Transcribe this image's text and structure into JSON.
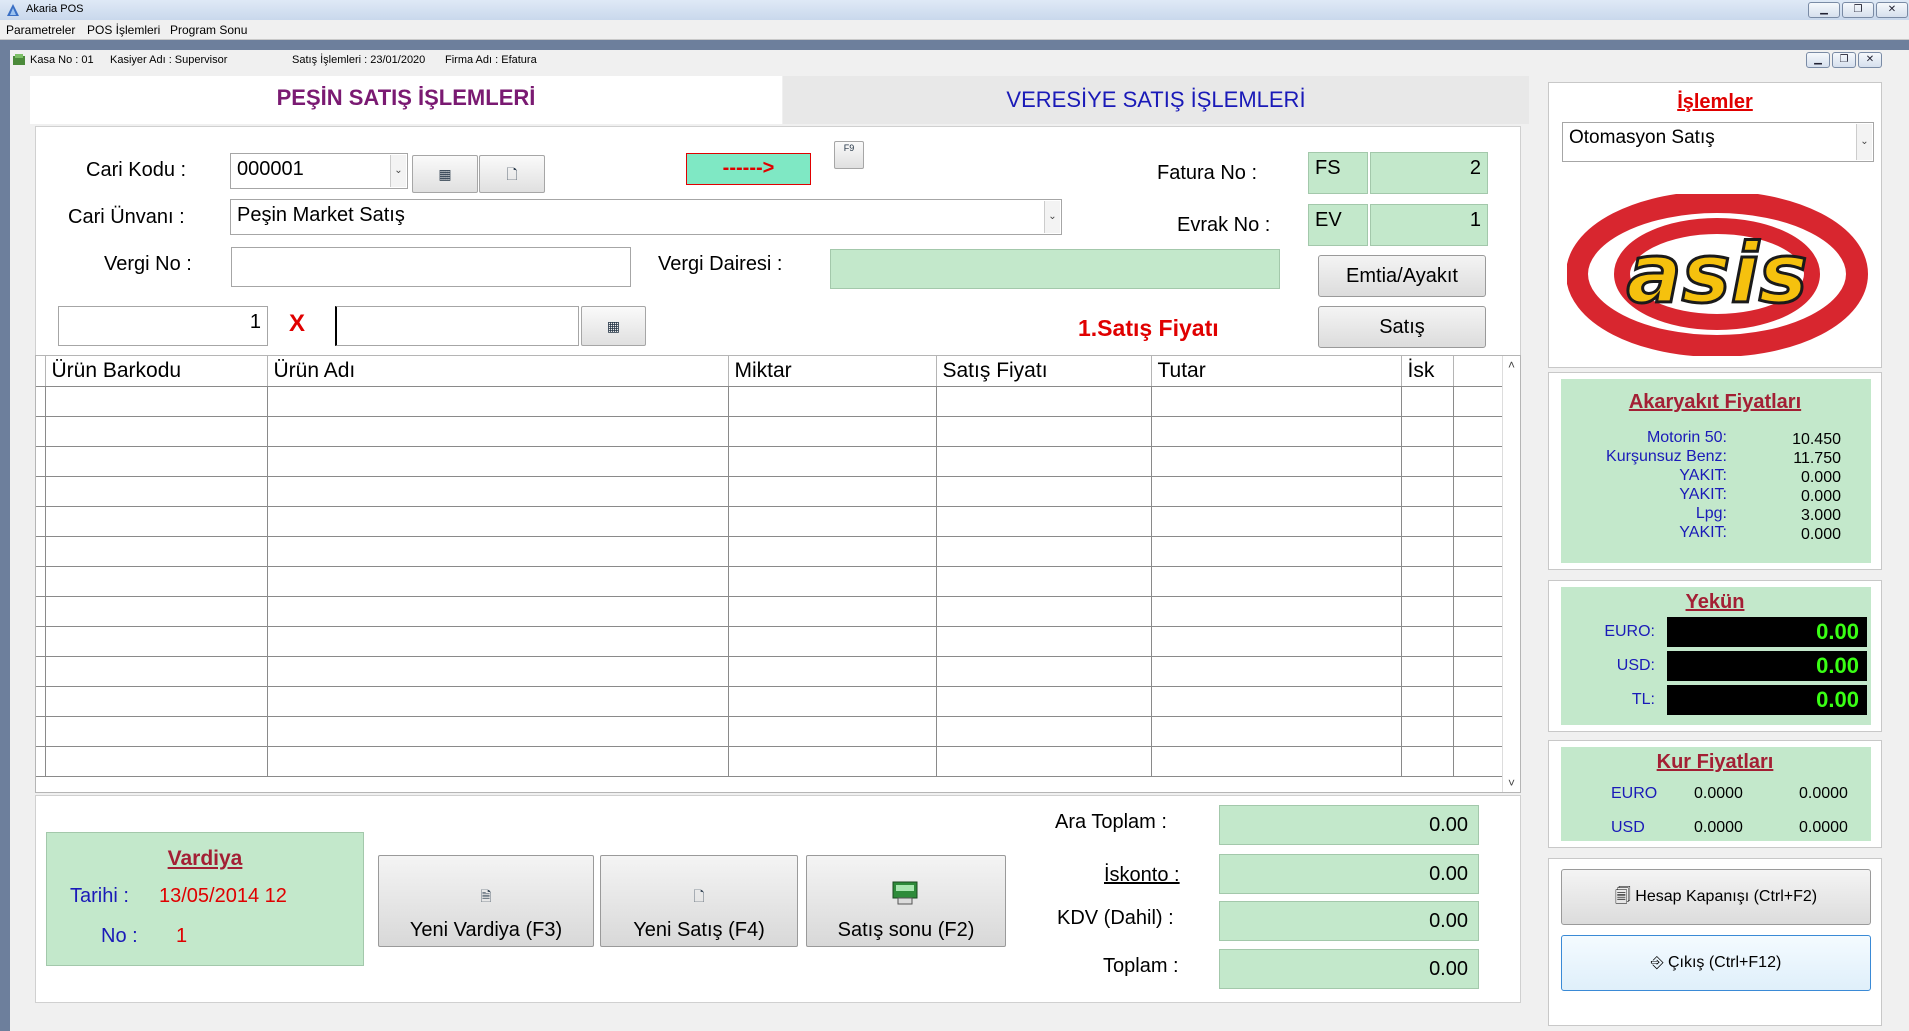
{
  "app": {
    "window_title": "Akaria POS",
    "menu": [
      "Parametreler",
      "POS İşlemleri",
      "Program Sonu"
    ]
  },
  "status": {
    "kasa": "Kasa No : 01",
    "kasiyer": "Kasiyer Adı : Supervisor",
    "satis_tarih": "Satış İşlemleri : 23/01/2020",
    "firma": "Firma Adı : Efatura"
  },
  "tabs": {
    "pesin": "PEŞİN SATIŞ İŞLEMLERİ",
    "veresiye": "VERESİYE SATIŞ İŞLEMLERİ"
  },
  "form": {
    "cari_kodu_label": "Cari Kodu :",
    "cari_kodu_value": "000001",
    "cari_unvani_label": "Cari Ünvanı :",
    "cari_unvani_value": "Peşin Market Satış",
    "vergi_no_label": "Vergi No :",
    "vergi_no_value": "",
    "vergi_dairesi_label": "Vergi Dairesi :",
    "vergi_dairesi_value": "",
    "arrow_text": "------>",
    "f9_key": "F9",
    "fatura_no_label": "Fatura  No :",
    "fatura_seri": "FS",
    "fatura_no": "2",
    "evrak_no_label": "Evrak No :",
    "evrak_seri": "EV",
    "evrak_no": "1",
    "emtia_button": "Emtia/Ayakıt",
    "satis_button": "Satış",
    "qty_value": "1",
    "multiply": "X",
    "barcode_value": "",
    "price_type": "1.Satış Fiyatı"
  },
  "grid": {
    "columns": [
      "Ürün Barkodu",
      "Ürün Adı",
      "Miktar",
      "Satış Fiyatı",
      "Tutar",
      "İsk",
      ""
    ],
    "rows": 13
  },
  "vardiya": {
    "title": "Vardiya",
    "tarih_label": "Tarihi :",
    "tarih_value": "13/05/2014 12",
    "no_label": "No :",
    "no_value": "1"
  },
  "actions": {
    "yeni_vardiya": "Yeni Vardiya (F3)",
    "yeni_satis": "Yeni Satış (F4)",
    "satis_sonu": "Satış sonu (F2)"
  },
  "totals": {
    "ara_toplam_label": "Ara Toplam :",
    "ara_toplam": "0.00",
    "iskonto_label": "İskonto :",
    "iskonto": "0.00",
    "kdv_label": "KDV (Dahil) :",
    "kdv": "0.00",
    "toplam_label": "Toplam :",
    "toplam": "0.00"
  },
  "sidebar": {
    "islemler_title": "İşlemler",
    "islemler_value": "Otomasyon Satış",
    "logo_text": "asis",
    "fuel_title": "Akaryakıt Fiyatları",
    "fuel": [
      {
        "name": "Motorin 50:",
        "price": "10.450"
      },
      {
        "name": "Kurşunsuz Benz:",
        "price": "11.750"
      },
      {
        "name": "YAKIT:",
        "price": "0.000"
      },
      {
        "name": "YAKIT:",
        "price": "0.000"
      },
      {
        "name": "Lpg:",
        "price": "3.000"
      },
      {
        "name": "YAKIT:",
        "price": "0.000"
      }
    ],
    "yekun_title": "Yekün",
    "yekun": [
      {
        "cur": "EURO:",
        "val": "0.00"
      },
      {
        "cur": "USD:",
        "val": "0.00"
      },
      {
        "cur": "TL:",
        "val": "0.00"
      }
    ],
    "kur_title": "Kur Fiyatları",
    "kur": [
      {
        "cur": "EURO",
        "a": "0.0000",
        "b": "0.0000"
      },
      {
        "cur": "USD",
        "a": "0.0000",
        "b": "0.0000"
      }
    ],
    "hesap_button": "Hesap Kapanışı (Ctrl+F2)",
    "cikis_button": "Çıkış (Ctrl+F12)"
  },
  "colors": {
    "green_field": "#c3e8cb",
    "tab_pesin": "#7a1a72",
    "tab_veresiye": "#1a1ab8",
    "accent_red": "#e00000"
  }
}
